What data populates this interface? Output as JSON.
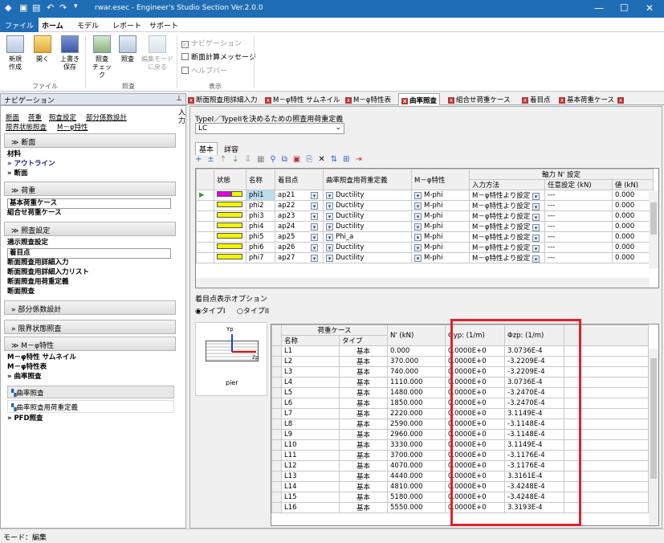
{
  "title": "rwar.esec - Engineer's Studio Section Ver.2.0.0",
  "ribbon_tabs": [
    "ファイル",
    "ホーム",
    "モデル",
    "レポート",
    "サポート"
  ],
  "ribbon": {
    "file_buttons": [
      "新規\n作成",
      "開く",
      "上書き\n保存"
    ],
    "check_buttons": [
      "照査\nチェック",
      "照査",
      "編集モード\nに戻る"
    ],
    "group_file": "ファイル",
    "group_check": "照査",
    "group_view": "表示",
    "view_checks": [
      "ナビゲーション",
      "断面計算メッセージ",
      "ヘルプバー"
    ]
  },
  "nav": {
    "header": "ナビゲーション",
    "links_row1": [
      "断面",
      "荷重",
      "照査設定",
      "部分係数設計"
    ],
    "links_row2": [
      "限界状態照査",
      "M－φ特性"
    ],
    "side_label": "入力",
    "sections": {
      "dm": "断面",
      "hk": "荷重",
      "sh": "照査設定",
      "bb": "部分係数設計",
      "gj": "限界状態照査",
      "mp": "M－φ特性"
    },
    "dm_items": [
      "材料",
      "アウトライン",
      "断面"
    ],
    "hk_items": [
      "基本荷重ケース",
      "組合せ荷重ケース"
    ],
    "sh_items": [
      "適示照査設定",
      "着目点",
      "断面照査用詳細入力",
      "断面照査用詳細入力リスト",
      "断面照査用荷重定義",
      "断面照査"
    ],
    "mp_items": [
      "M－φ特性 サムネイル",
      "M－φ特性表",
      "曲率照査"
    ],
    "mp_sub": [
      "曲率照査",
      "曲率照査用荷重定義"
    ],
    "mp_last": "PFD照査"
  },
  "doc_tabs": [
    "断面照査用詳細入力",
    "M－φ特性 サムネイル",
    "M－φ特性表",
    "曲率照査",
    "組合せ荷重ケース",
    "着目点",
    "基本荷重ケース"
  ],
  "content": {
    "type_label": "TypeI／TypeIIを決めるための照査用荷重定義",
    "type_value": "LC",
    "subtabs": [
      "基本",
      "詳容"
    ],
    "top_headers": {
      "status": "状態",
      "name": "名称",
      "point": "着目点",
      "def": "曲率照査用荷重定義",
      "mphi": "M－φ特性",
      "axial": "軸力 N' 設定",
      "method": "入力方法",
      "arbitrary": "任意設定 (kN)",
      "value": "値 (kN)"
    },
    "top_rows": [
      {
        "name": "phi1",
        "point": "ap21",
        "def": "Ductility",
        "mphi": "M-phi",
        "method": "M－φ特性より設定",
        "arb": "---",
        "val": "0.000"
      },
      {
        "name": "phi2",
        "point": "ap22",
        "def": "Ductility",
        "mphi": "M-phi",
        "method": "M－φ特性より設定",
        "arb": "---",
        "val": "0.000"
      },
      {
        "name": "phi3",
        "point": "ap23",
        "def": "Ductility",
        "mphi": "M-phi",
        "method": "M－φ特性より設定",
        "arb": "---",
        "val": "0.000"
      },
      {
        "name": "phi4",
        "point": "ap24",
        "def": "Ductility",
        "mphi": "M-phi",
        "method": "M－φ特性より設定",
        "arb": "---",
        "val": "0.000"
      },
      {
        "name": "phi5",
        "point": "ap25",
        "def": "Phi_a",
        "mphi": "M-phi",
        "method": "M－φ特性より設定",
        "arb": "---",
        "val": "0.000"
      },
      {
        "name": "phi6",
        "point": "ap26",
        "def": "Ductility",
        "mphi": "M-phi",
        "method": "M－φ特性より設定",
        "arb": "---",
        "val": "0.000"
      },
      {
        "name": "phi7",
        "point": "ap27",
        "def": "Ductility",
        "mphi": "M-phi",
        "method": "M－φ特性より設定",
        "arb": "---",
        "val": "0.000"
      }
    ],
    "option_label": "着目点表示オプション",
    "radio_1": "タイプI",
    "radio_2": "タイプII",
    "thumb_y": "Yp",
    "thumb_z": "Zp",
    "thumb_caption": "pier",
    "bottom_headers": {
      "group": "荷重ケース",
      "name": "名称",
      "type": "タイプ",
      "n": "N' (kN)",
      "phiy": "Φyp: (1/m)",
      "phiz": "Φzp: (1/m)"
    },
    "bottom_rows": [
      {
        "name": "L1",
        "type": "基本",
        "n": "0.000",
        "y": "0.0000E+0",
        "z": "3.0736E-4"
      },
      {
        "name": "L2",
        "type": "基本",
        "n": "370.000",
        "y": "0.0000E+0",
        "z": "-3.2209E-4"
      },
      {
        "name": "L3",
        "type": "基本",
        "n": "740.000",
        "y": "0.0000E+0",
        "z": "-3.2209E-4"
      },
      {
        "name": "L4",
        "type": "基本",
        "n": "1110.000",
        "y": "0.0000E+0",
        "z": "3.0736E-4"
      },
      {
        "name": "L5",
        "type": "基本",
        "n": "1480.000",
        "y": "0.0000E+0",
        "z": "-3.2470E-4"
      },
      {
        "name": "L6",
        "type": "基本",
        "n": "1850.000",
        "y": "0.0000E+0",
        "z": "-3.2470E-4"
      },
      {
        "name": "L7",
        "type": "基本",
        "n": "2220.000",
        "y": "0.0000E+0",
        "z": "3.1149E-4"
      },
      {
        "name": "L8",
        "type": "基本",
        "n": "2590.000",
        "y": "0.0000E+0",
        "z": "-3.1148E-4"
      },
      {
        "name": "L9",
        "type": "基本",
        "n": "2960.000",
        "y": "0.0000E+0",
        "z": "-3.1148E-4"
      },
      {
        "name": "L10",
        "type": "基本",
        "n": "3330.000",
        "y": "0.0000E+0",
        "z": "3.1149E-4"
      },
      {
        "name": "L11",
        "type": "基本",
        "n": "3700.000",
        "y": "0.0000E+0",
        "z": "-3.1176E-4"
      },
      {
        "name": "L12",
        "type": "基本",
        "n": "4070.000",
        "y": "0.0000E+0",
        "z": "-3.1176E-4"
      },
      {
        "name": "L13",
        "type": "基本",
        "n": "4440.000",
        "y": "0.0000E+0",
        "z": "3.3161E-4"
      },
      {
        "name": "L14",
        "type": "基本",
        "n": "4810.000",
        "y": "0.0000E+0",
        "z": "-3.4248E-4"
      },
      {
        "name": "L15",
        "type": "基本",
        "n": "5180.000",
        "y": "0.0000E+0",
        "z": "-3.4248E-4"
      },
      {
        "name": "L16",
        "type": "基本",
        "n": "5550.000",
        "y": "0.0000E+0",
        "z": "3.3193E-4"
      }
    ]
  },
  "status": "モード：編集",
  "colors": {
    "titlebar": "#1f6db5",
    "highlight": "#e0202e",
    "status_bar_magenta": "#e400e4",
    "status_bar_yellow": "#f5f500"
  }
}
